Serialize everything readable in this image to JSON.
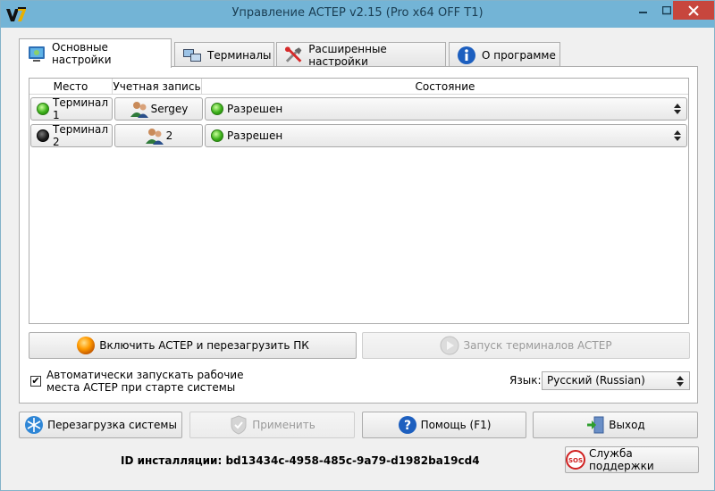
{
  "window": {
    "title": "Управление ACTEP v2.15 (Pro x64 OFF T1)",
    "app_icon": "v7-logo",
    "controls": [
      "minimize-icon",
      "maximize-icon",
      "close-icon"
    ]
  },
  "tabs": [
    {
      "label": "Основные настройки",
      "icon": "settings-icon",
      "active": true
    },
    {
      "label": "Терминалы",
      "icon": "terminals-icon",
      "active": false
    },
    {
      "label": "Расширенные настройки",
      "icon": "tools-icon",
      "active": false
    },
    {
      "label": "О программе",
      "icon": "info-icon",
      "active": false
    }
  ],
  "table": {
    "columns": [
      "Место",
      "Учетная запись",
      "Состояние"
    ],
    "rows": [
      {
        "place": "Терминал 1",
        "place_status": "green",
        "account": "Sergey",
        "state": "Разрешен",
        "state_status": "green"
      },
      {
        "place": "Терминал 2",
        "place_status": "black",
        "account": "2",
        "state": "Разрешен",
        "state_status": "green"
      }
    ]
  },
  "actions": {
    "enable_restart": "Включить ACTEP и перезагрузить ПК",
    "start_terminals": "Запуск терминалов ACTEP"
  },
  "autostart": {
    "checked": true,
    "label_line1": "Автоматически запускать  рабочие",
    "label_line2": "места ACTEP при старте системы"
  },
  "language": {
    "label": "Язык:",
    "value": "Русский (Russian)"
  },
  "bottom_buttons": {
    "reboot": "Перезагрузка системы",
    "apply": "Применить",
    "help": "Помощь (F1)",
    "exit": "Выход"
  },
  "install_id": "ID инсталляции: bd13434c-4958-485c-9a79-d1982ba19cd4",
  "support": "Служба поддержки",
  "colors": {
    "titlebar": "#73b4d6",
    "close": "#c7463d",
    "status_green": "#3cb01a",
    "status_black": "#1a1a1a"
  }
}
